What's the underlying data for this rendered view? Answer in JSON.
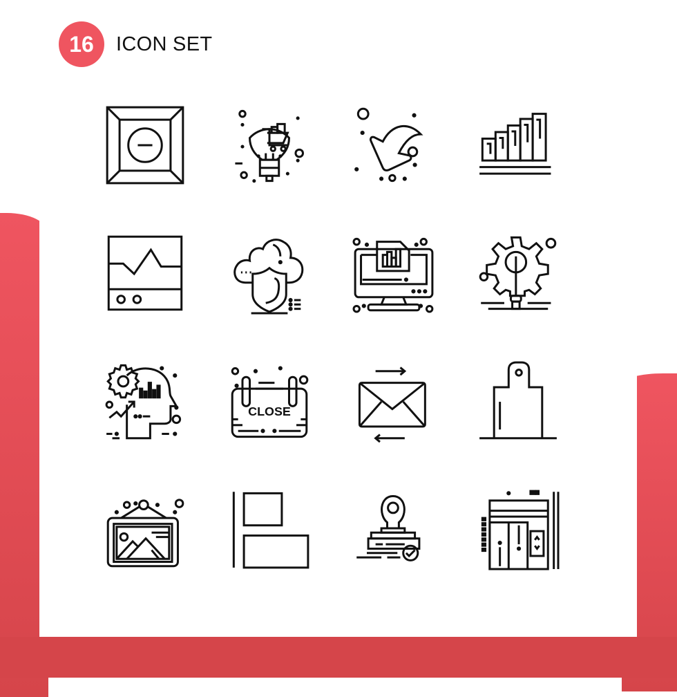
{
  "header": {
    "count": "16",
    "title": "ICON SET"
  },
  "colors": {
    "accent": "#ef5560",
    "accent_dark": "#d5454a",
    "stroke": "#111111",
    "panel": "#ffffff"
  },
  "icons": [
    {
      "name": "box-minus-icon"
    },
    {
      "name": "lightbulb-shopping-cart-icon"
    },
    {
      "name": "curved-arrow-down-left-icon"
    },
    {
      "name": "growth-bar-chart-icon"
    },
    {
      "name": "monitor-line-graph-icon"
    },
    {
      "name": "cloud-shield-icon"
    },
    {
      "name": "computer-report-chart-icon"
    },
    {
      "name": "gear-lightbulb-icon"
    },
    {
      "name": "head-gear-analytics-icon"
    },
    {
      "name": "close-sign-icon"
    },
    {
      "name": "email-exchange-icon"
    },
    {
      "name": "cutting-board-icon"
    },
    {
      "name": "framed-picture-icon"
    },
    {
      "name": "align-left-icon"
    },
    {
      "name": "approved-stamp-icon"
    },
    {
      "name": "elevator-icon"
    }
  ],
  "close_sign_text": "CLOSE"
}
